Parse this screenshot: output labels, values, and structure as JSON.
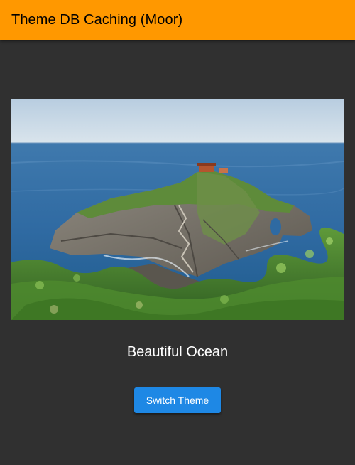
{
  "app_bar": {
    "title": "Theme DB Caching (Moor)",
    "color": "#ff9800"
  },
  "main": {
    "image": {
      "subject": "rocky island with stone stairway and small hermitage in the ocean, green shrubs in the foreground"
    },
    "caption": "Beautiful Ocean",
    "switch_button": {
      "label": "Switch Theme",
      "color": "#1e88e5"
    },
    "background_color": "#303030"
  }
}
